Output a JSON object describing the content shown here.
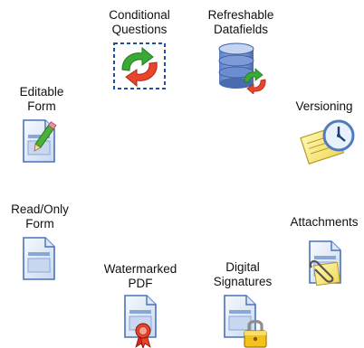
{
  "features": {
    "conditional_questions": {
      "label": "Conditional\nQuestions",
      "icon": "recycle-arrows-icon"
    },
    "refreshable_datafields": {
      "label": "Refreshable\nDatafields",
      "icon": "database-refresh-icon"
    },
    "editable_form": {
      "label": "Editable\nForm",
      "icon": "document-pencil-icon"
    },
    "versioning": {
      "label": "Versioning",
      "icon": "document-clock-icon"
    },
    "read_only_form": {
      "label": "Read/Only\nForm",
      "icon": "document-icon"
    },
    "attachments": {
      "label": "Attachments",
      "icon": "document-paperclip-icon"
    },
    "watermarked_pdf": {
      "label": "Watermarked\nPDF",
      "icon": "document-ribbon-icon"
    },
    "digital_signatures": {
      "label": "Digital\nSignatures",
      "icon": "document-lock-icon"
    }
  },
  "colors": {
    "doc_blue": "#4a72b8",
    "doc_fill": "#eef3fb",
    "green_arrow": "#3aaa35",
    "red_arrow": "#e8452c",
    "dashed_border": "#1f4fa8"
  }
}
